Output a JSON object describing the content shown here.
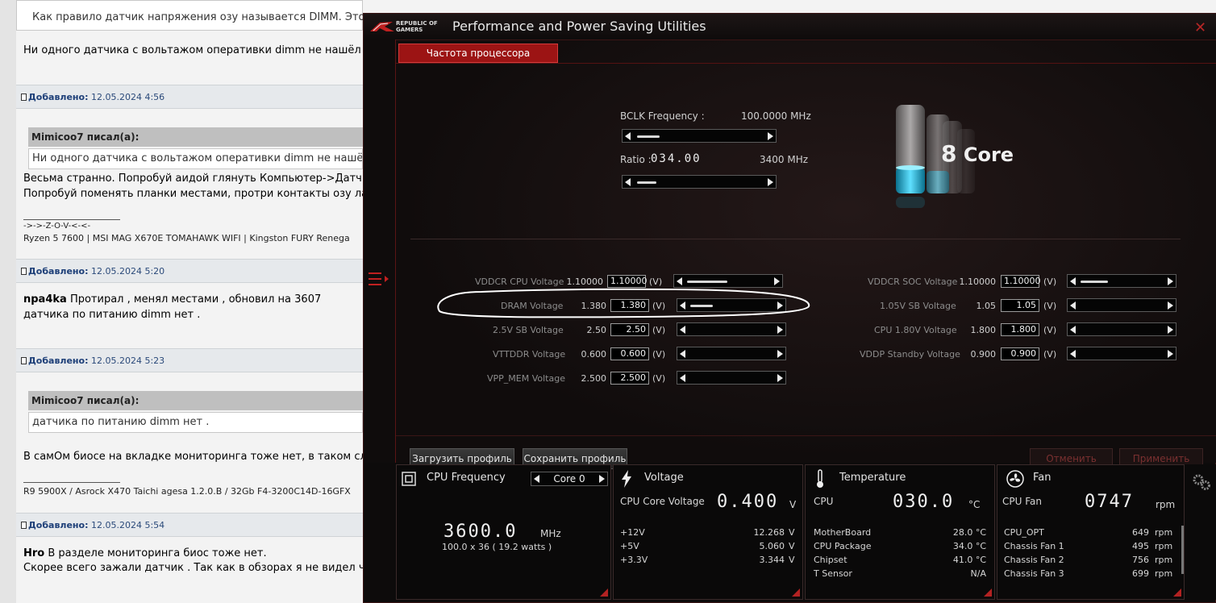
{
  "forum": {
    "top_quote": "Как правило датчик напряжения озу называется DIMM. Это",
    "post1_text": "Ни одного датчика с вольтажом оперативки dimm не нашёл .",
    "post2": {
      "added_label": "Добавлено:",
      "date": "12.05.2024 4:56",
      "quote_author": "Mimicoo7 писал(а):",
      "quote_text": "Ни одного датчика с вольтажом оперативки dimm не нашёл",
      "line1": "Весьма странно. Попробуй аидой глянуть Компьютер->Датчи",
      "line2": "Попробуй поменять планки местами, протри контакты озу ла",
      "sig_nick": "->->-Z-O-V-<-<-",
      "sig_spec": "Ryzen 5 7600 | MSI MAG X670E TOMAHAWK WIFI | Kingston FURY Renega"
    },
    "post3": {
      "added_label": "Добавлено:",
      "date": "12.05.2024 5:20",
      "author": "npa4ka",
      "line1": "Протирал , менял местами , обновил на 3607",
      "line2": "датчика по питанию dimm нет ."
    },
    "post4": {
      "added_label": "Добавлено:",
      "date": "12.05.2024 5:23",
      "quote_author": "Mimicoo7 писал(а):",
      "quote_text": "датчика по питанию dimm нет .",
      "line1": "В самОм биосе на вкладке мониторинга тоже нет, в таком слу",
      "sig_spec": "R9 5900X / Asrock X470 Taichi agesa 1.2.0.B / 32Gb F4-3200C14D-16GFX"
    },
    "post5": {
      "added_label": "Добавлено:",
      "date": "12.05.2024 5:54",
      "author": "Hro",
      "line1": "В разделе мониторинга биос тоже нет.",
      "line2": "Скорее всего зажали датчик . Так как в обзорах я не видел ч"
    }
  },
  "app": {
    "logo_line1": "REPUBLIC OF",
    "logo_line2": "GAMERS",
    "title": "Performance and Power Saving Utilities",
    "tab_active": "Частота процессора",
    "bclk_label": "BCLK Frequency :",
    "bclk_value": "100.0000 MHz",
    "ratio_label": "Ratio :",
    "ratio_value": "034.00",
    "ratio_mhz": "3400 MHz",
    "core_count": "8",
    "core_word": "Core",
    "unit_v": "(V)",
    "left_voltages": [
      {
        "name": "VDDCR CPU Voltage",
        "current": "1.10000",
        "input": "1.10000"
      },
      {
        "name": "DRAM Voltage",
        "current": "1.380",
        "input": "1.380"
      },
      {
        "name": "2.5V SB Voltage",
        "current": "2.50",
        "input": "2.50"
      },
      {
        "name": "VTTDDR Voltage",
        "current": "0.600",
        "input": "0.600"
      },
      {
        "name": "VPP_MEM Voltage",
        "current": "2.500",
        "input": "2.500"
      }
    ],
    "right_voltages": [
      {
        "name": "VDDCR SOC Voltage",
        "current": "1.10000",
        "input": "1.10000"
      },
      {
        "name": "1.05V SB Voltage",
        "current": "1.05",
        "input": "1.05"
      },
      {
        "name": "CPU 1.80V Voltage",
        "current": "1.800",
        "input": "1.800"
      },
      {
        "name": "VDDP Standby Voltage",
        "current": "0.900",
        "input": "0.900"
      }
    ],
    "buttons": {
      "load_profile": "Загрузить профиль",
      "save_profile": "Сохранить профиль",
      "cancel": "Отменить",
      "apply": "Применить"
    }
  },
  "monitor": {
    "cpu_freq": {
      "title": "CPU Frequency",
      "core_select": "Core 0",
      "value": "3600.0",
      "unit": "MHz",
      "detail": "100.0  x 36    ( 19.2   watts )"
    },
    "voltage": {
      "title": "Voltage",
      "core_label": "CPU Core Voltage",
      "core_value": "0.400",
      "core_unit": "V",
      "rows": [
        {
          "name": "+12V",
          "value": "12.268",
          "unit": "V"
        },
        {
          "name": "+5V",
          "value": "5.060",
          "unit": "V"
        },
        {
          "name": "+3.3V",
          "value": "3.344",
          "unit": "V"
        }
      ]
    },
    "temperature": {
      "title": "Temperature",
      "cpu_label": "CPU",
      "cpu_value": "030.0",
      "cpu_unit": "°C",
      "rows": [
        {
          "name": "MotherBoard",
          "value": "28.0 °C"
        },
        {
          "name": "CPU Package",
          "value": "34.0 °C"
        },
        {
          "name": "Chipset",
          "value": "41.0 °C"
        },
        {
          "name": "T Sensor",
          "value": "N/A"
        }
      ]
    },
    "fan": {
      "title": "Fan",
      "cpu_label": "CPU Fan",
      "cpu_value": "0747",
      "cpu_unit": "rpm",
      "rows": [
        {
          "name": "CPU_OPT",
          "value": "649",
          "unit": "rpm"
        },
        {
          "name": "Chassis Fan 1",
          "value": "495",
          "unit": "rpm"
        },
        {
          "name": "Chassis Fan 2",
          "value": "756",
          "unit": "rpm"
        },
        {
          "name": "Chassis Fan 3",
          "value": "699",
          "unit": "rpm"
        }
      ]
    }
  },
  "colors": {
    "accent_red": "#9c1414",
    "liquid_blue": "#18b4e0"
  }
}
